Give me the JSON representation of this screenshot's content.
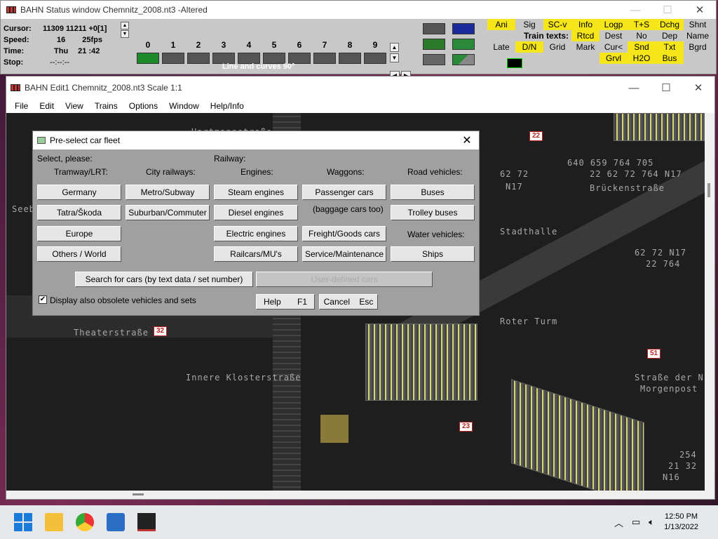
{
  "status_window": {
    "title": "BAHN Status window Chemnitz_2008.nt3 -Altered",
    "cursor_label": "Cursor:",
    "cursor_value": "11309 11211 +0[1]",
    "speed_label": "Speed:",
    "speed_value": "16",
    "fps_value": "25fps",
    "time_label": "Time:",
    "time_day": "Thu",
    "time_value": "21 :42",
    "stop_label": "Stop:",
    "stop_value": "--:--:--",
    "track_numbers": [
      "0",
      "1",
      "2",
      "3",
      "4",
      "5",
      "6",
      "7",
      "8",
      "9"
    ],
    "track_mode_label": "Line and curves 90°",
    "buttons_row1": [
      "Ani",
      "Sig",
      "SC-v",
      "Info",
      "Logp",
      "T+S",
      "Dchg",
      "Shnt"
    ],
    "train_texts_label": "Train texts:",
    "buttons_row2": [
      "Rtcd",
      "Dest",
      "No",
      "Dep",
      "Name",
      "Late"
    ],
    "buttons_row3": [
      "D/N",
      "Grid",
      "Mark",
      "Cur<",
      "Snd",
      "Txt",
      "Bgrd"
    ],
    "buttons_row4": [
      "Grvl",
      "H2O",
      "Bus"
    ]
  },
  "edit_window": {
    "title": "BAHN Edit1 Chemnitz_2008.nt3 Scale 1:1",
    "menu": [
      "File",
      "Edit",
      "View",
      "Trains",
      "Options",
      "Window",
      "Help/Info"
    ]
  },
  "map": {
    "streets": [
      "Hartmannstraße",
      "Brückenstraße",
      "Stadthalle",
      "Roter Turm",
      "Theaterstraße",
      "Innere Klosterstraße",
      "Straße der N",
      "Morgenpost",
      "Seeb"
    ],
    "route_tags": [
      "22",
      "32",
      "51",
      "23"
    ],
    "route_texts": [
      "62 72",
      "N17",
      "62 72 N17",
      "22 764",
      "22 62 72 764 N17",
      "640 659 764 705",
      "254",
      "21 32",
      "N16"
    ]
  },
  "dialog": {
    "title": "Pre-select car fleet",
    "select_label": "Select, please:",
    "railway_label": "Railway:",
    "col_tram": "Tramway/LRT:",
    "col_city": "City railways:",
    "col_engines": "Engines:",
    "col_waggons": "Waggons:",
    "col_road": "Road vehicles:",
    "water_label": "Water vehicles:",
    "baggage_note": "(baggage cars too)",
    "tram_buttons": [
      "Germany",
      "Tatra/Škoda",
      "Europe",
      "Others / World"
    ],
    "city_buttons": [
      "Metro/Subway",
      "Suburban/Commuter"
    ],
    "engine_buttons": [
      "Steam engines",
      "Diesel engines",
      "Electric engines",
      "Railcars/MU's"
    ],
    "waggon_buttons": [
      "Passenger cars",
      "Freight/Goods cars",
      "Service/Maintenance"
    ],
    "road_buttons": [
      "Buses",
      "Trolley buses"
    ],
    "water_buttons": [
      "Ships"
    ],
    "search_button": "Search for cars (by text data / set number)",
    "user_defined_button": "User-defined cars",
    "obsolete_checkbox": "Display also obsolete vehicles and sets",
    "help_button": "Help",
    "help_key": "F1",
    "cancel_button": "Cancel",
    "cancel_key": "Esc"
  },
  "taskbar": {
    "time": "12:50 PM",
    "date": "1/13/2022"
  }
}
